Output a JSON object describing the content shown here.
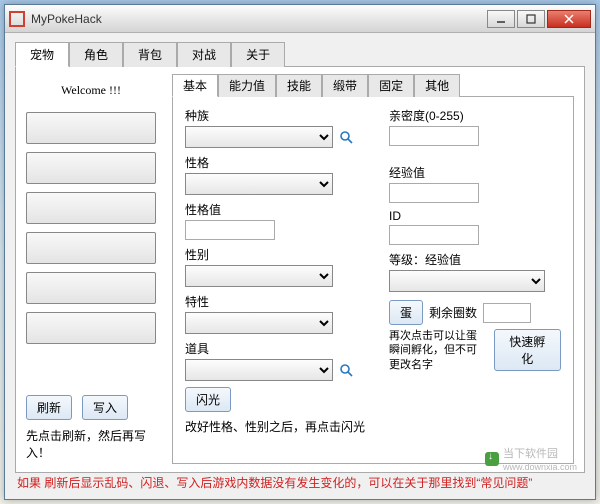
{
  "window": {
    "title": "MyPokeHack"
  },
  "main_tabs": [
    "宠物",
    "角色",
    "背包",
    "对战",
    "关于"
  ],
  "main_tab_active": 0,
  "left": {
    "welcome": "Welcome !!!",
    "refresh": "刷新",
    "write": "写入",
    "hint": "先点击刷新，然后再写入！"
  },
  "sub_tabs": [
    "基本",
    "能力值",
    "技能",
    "缎带",
    "固定",
    "其他"
  ],
  "sub_tab_active": 0,
  "form": {
    "species_label": "种族",
    "nature_label": "性格",
    "nature_val_label": "性格值",
    "gender_label": "性别",
    "ability_label": "特性",
    "item_label": "道具",
    "friendship_label": "亲密度(0-255)",
    "exp_label": "经验值",
    "id_label": "ID",
    "level_label": "等级：经验值",
    "egg_btn": "蛋",
    "egg_cycles_label": "剩余圈数",
    "egg_hint": "再次点击可以让蛋瞬间孵化，但不可更改名字",
    "quick_hatch_btn": "快速孵化",
    "shiny_btn": "闪光",
    "shiny_hint": "改好性格、性别之后，再点击闪光"
  },
  "footer": "如果 刷新后显示乱码、闪退、写入后游戏内数据没有发生变化的，可以在关于那里找到“常见问题”",
  "watermark": {
    "text1": "当下软件园",
    "text2": "www.downxia.com"
  }
}
